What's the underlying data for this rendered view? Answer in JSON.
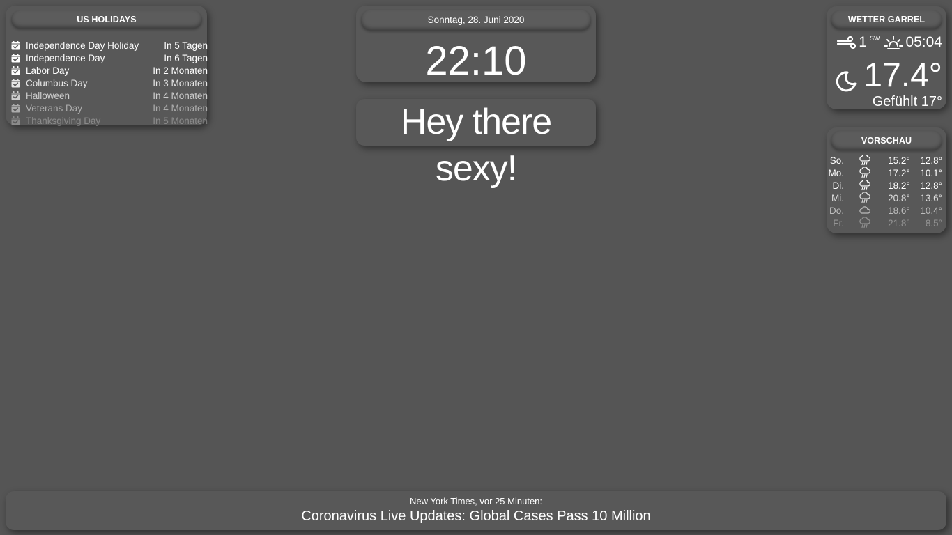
{
  "holidays": {
    "title": "US HOLIDAYS",
    "icon": "calendar-check-icon",
    "items": [
      {
        "name": "Independence Day Holiday",
        "when": "In 5 Tagen",
        "opacity": 1.0
      },
      {
        "name": "Independence Day",
        "when": "In 6 Tagen",
        "opacity": 1.0
      },
      {
        "name": "Labor Day",
        "when": "In 2 Monaten",
        "opacity": 1.0
      },
      {
        "name": "Columbus Day",
        "when": "In 3 Monaten",
        "opacity": 0.85
      },
      {
        "name": "Halloween",
        "when": "In 4 Monaten",
        "opacity": 0.7
      },
      {
        "name": "Veterans Day",
        "when": "In 4 Monaten",
        "opacity": 0.5
      },
      {
        "name": "Thanksgiving Day",
        "when": "In 5 Monaten",
        "opacity": 0.3
      }
    ]
  },
  "clock": {
    "date": "Sonntag, 28. Juni 2020",
    "time": "22:10"
  },
  "greeting": {
    "text": "Hey there sexy!"
  },
  "weather": {
    "title": "WETTER GARREL",
    "wind_speed": "1",
    "wind_direction": "SW",
    "sun_time": "05:04",
    "temperature": "17.4°",
    "feels_like": "Gefühlt 17°",
    "icons": {
      "wind": "wind-icon",
      "sunrise": "sunrise-icon",
      "condition": "moon-night-icon"
    }
  },
  "forecast": {
    "title": "VORSCHAU",
    "days": [
      {
        "day": "So.",
        "icon": "rain-cloud-icon",
        "high": "15.2°",
        "low": "12.8°",
        "opacity": 1.0
      },
      {
        "day": "Mo.",
        "icon": "rain-cloud-icon",
        "high": "17.2°",
        "low": "10.1°",
        "opacity": 1.0
      },
      {
        "day": "Di.",
        "icon": "rain-cloud-icon",
        "high": "18.2°",
        "low": "12.8°",
        "opacity": 1.0
      },
      {
        "day": "Mi.",
        "icon": "rain-cloud-icon",
        "high": "20.8°",
        "low": "13.6°",
        "opacity": 0.8
      },
      {
        "day": "Do.",
        "icon": "cloud-icon",
        "high": "18.6°",
        "low": "10.4°",
        "opacity": 0.6
      },
      {
        "day": "Fr.",
        "icon": "rain-cloud-icon",
        "high": "21.8°",
        "low": "8.5°",
        "opacity": 0.35
      }
    ]
  },
  "news": {
    "source": "New York Times, vor 25 Minuten:",
    "headline": "Coronavirus Live Updates: Global Cases Pass 10 Million"
  }
}
